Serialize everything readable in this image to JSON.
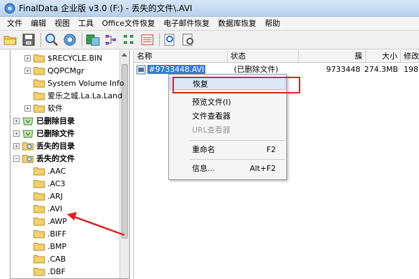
{
  "window": {
    "title": "FinalData 企业版 v3.0 (F:) - 丢失的文件\\.AVI"
  },
  "menu": [
    "文件",
    "编辑",
    "视图",
    "工具",
    "Office文件恢复",
    "电子邮件恢复",
    "数据库恢复",
    "帮助"
  ],
  "toolbar": {
    "icons": [
      "open-folder-icon",
      "save-icon",
      "search-icon",
      "gear-icon",
      "export-icon",
      "network-icon",
      "tree-icon",
      "list-icon",
      "grid-icon",
      "find-icon",
      "zoom-icon"
    ]
  },
  "tree": {
    "nodes": [
      {
        "label": "$RECYCLE.BIN",
        "expander": "+",
        "bold": false
      },
      {
        "label": "QQPCMgr",
        "expander": "+",
        "bold": false
      },
      {
        "label": "System Volume Info",
        "expander": "",
        "bold": false
      },
      {
        "label": "爱乐之城.La.La.Land",
        "expander": "",
        "bold": false
      },
      {
        "label": "软件",
        "expander": "+",
        "bold": false
      },
      {
        "label": "已删除目录",
        "expander": "+",
        "bold": true
      },
      {
        "label": "已删除文件",
        "expander": "+",
        "bold": true
      },
      {
        "label": "丢失的目录",
        "expander": "+",
        "bold": true
      },
      {
        "label": "丢失的文件",
        "expander": "−",
        "bold": true
      },
      {
        "label": ".AAC",
        "expander": "",
        "bold": false
      },
      {
        "label": ".AC3",
        "expander": "",
        "bold": false
      },
      {
        "label": ".ARJ",
        "expander": "",
        "bold": false
      },
      {
        "label": ".AVI",
        "expander": "",
        "bold": false
      },
      {
        "label": ".AWP",
        "expander": "",
        "bold": false
      },
      {
        "label": ".BIFF",
        "expander": "",
        "bold": false
      },
      {
        "label": ".BMP",
        "expander": "",
        "bold": false
      },
      {
        "label": ".CAB",
        "expander": "",
        "bold": false
      },
      {
        "label": ".DBF",
        "expander": "",
        "bold": false
      }
    ]
  },
  "list": {
    "columns": [
      "名称",
      "状态",
      "簇",
      "大小",
      "修改"
    ],
    "rows": [
      {
        "name": "#9733448.AVI",
        "status": "(已删除文件)",
        "cluster": "9733448",
        "size": "274.3MB",
        "modified": "198"
      }
    ]
  },
  "context_menu": {
    "items": [
      {
        "label": "恢复",
        "shortcut": ""
      },
      {
        "label": "预览文件(I)",
        "shortcut": ""
      },
      {
        "label": "文件查看器",
        "shortcut": ""
      },
      {
        "label": "URL查看器",
        "shortcut": ""
      },
      {
        "label": "重命名",
        "shortcut": "F2"
      },
      {
        "label": "信息...",
        "shortcut": "Alt+F2"
      }
    ]
  },
  "colors": {
    "annotation": "#e02020",
    "selection": "#3a7bd5",
    "folder": "#f2d06b"
  }
}
